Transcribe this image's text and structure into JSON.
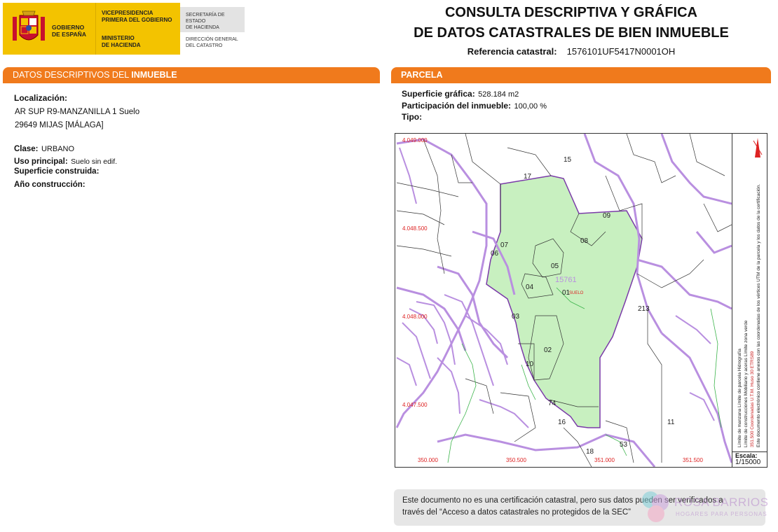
{
  "header": {
    "gobierno": [
      "GOBIERNO",
      "DE ESPAÑA"
    ],
    "vicepresidencia": [
      "VICEPRESIDENCIA",
      "PRIMERA DEL GOBIERNO"
    ],
    "ministerio": [
      "MINISTERIO",
      "DE HACIENDA"
    ],
    "secretaria": [
      "SECRETARÍA DE ESTADO",
      "DE HACIENDA"
    ],
    "direccion": [
      "DIRECCIÓN GENERAL",
      "DEL CATASTRO"
    ],
    "title_line1": "CONSULTA DESCRIPTIVA Y GRÁFICA",
    "title_line2": "DE DATOS CATASTRALES DE BIEN INMUEBLE",
    "ref_label": "Referencia catastral:",
    "ref_value": "1576101UF5417N0001OH"
  },
  "left": {
    "section_title_a": "DATOS DESCRIPTIVOS DEL ",
    "section_title_b": "INMUEBLE",
    "localizacion_label": "Localización:",
    "address1": "AR SUP R9-MANZANILLA 1 Suelo",
    "address2": "29649 MIJAS [MÁLAGA]",
    "clase_label": "Clase:",
    "clase_value": "URBANO",
    "uso_label": "Uso principal:",
    "uso_value": "Suelo sin edif.",
    "superficie_label": "Superficie construida:",
    "anio_label": "Año construcción:"
  },
  "right": {
    "section_title": "PARCELA",
    "sup_label": "Superficie gráfica:",
    "sup_value": "528.184 m2",
    "part_label": "Participación del inmueble:",
    "part_value": "100,00 %",
    "tipo_label": "Tipo:"
  },
  "map": {
    "coords_y": [
      "4.049.000",
      "4.048.500",
      "4.048.000",
      "4.047.500"
    ],
    "coords_x": [
      "350.000",
      "350.500",
      "351.000",
      "351.500"
    ],
    "parcel_numbers": [
      "15",
      "17",
      "09",
      "07",
      "06",
      "08",
      "05",
      "04",
      "01",
      "03",
      "02",
      "10",
      "74",
      "16",
      "18",
      "53",
      "11",
      "213"
    ],
    "manzana": "15761",
    "suelo": "SUELO",
    "legend_line1": "Límite de manzana     Límite de parcela     Hidrografía",
    "legend_line2": "Límite de construcciones     Mobiliario y aceras     Límite zona verde",
    "legend_line3": "351.500 Coordenadas U.T.M. Huso 30 ETRS89",
    "legend_line4": "Este documento electrónico contiene anexos con las coordenadas de los vértices UTM de la parcela y los datos de la certificación.",
    "escala_label": "Escala:",
    "escala_value": "1/15000"
  },
  "note": {
    "line1": "Este documento no es una certificación catastral, pero sus datos pueden ser verificados a",
    "line2": "través del “Acceso a datos catastrales no protegidos de la SEC”"
  },
  "watermark": {
    "name": "ROSA BARRIOS",
    "sub": "HOGARES PARA PERSONAS"
  },
  "colors": {
    "accent_orange": "#f07a1c",
    "gov_yellow": "#f3c300",
    "parcel_green": "#c8f0c0",
    "manzana_purple": "#b98fe0"
  }
}
